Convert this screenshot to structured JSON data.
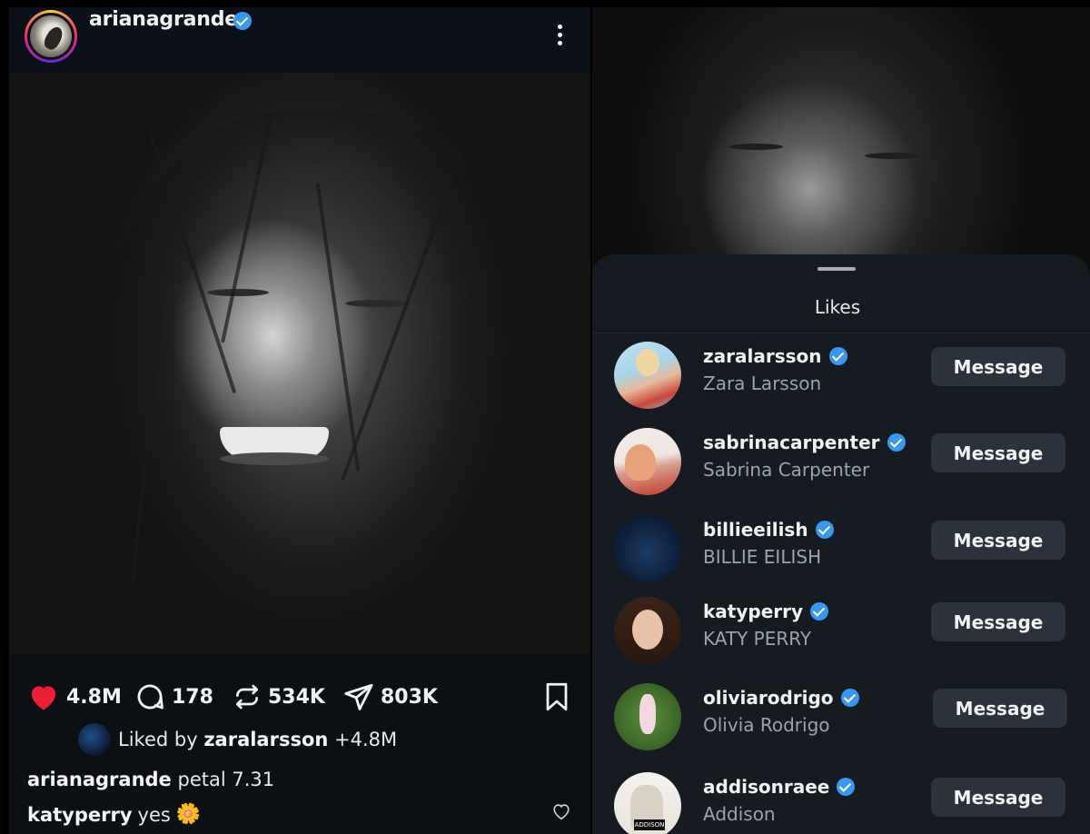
{
  "post": {
    "username": "arianagrande",
    "stats": {
      "likes": "4.8M",
      "comments": "178",
      "reposts": "534K",
      "shares": "803K"
    },
    "liked_by": {
      "prefix": "Liked by ",
      "user": "zaralarsson",
      "suffix": " +4.8M"
    },
    "caption": {
      "user": "arianagrande",
      "text": " petal 7.31"
    },
    "comment": {
      "user": "katyperry",
      "text": "yes",
      "emoji": "🌼"
    },
    "colors": {
      "like_red": "#ee1d36",
      "verified_blue": "#3897f0"
    }
  },
  "likes_sheet": {
    "title": "Likes",
    "button_label": "Message",
    "users": [
      {
        "username": "zaralarsson",
        "name": "Zara Larsson"
      },
      {
        "username": "sabrinacarpenter",
        "name": "Sabrina Carpenter"
      },
      {
        "username": "billieeilish",
        "name": "BILLIE EILISH"
      },
      {
        "username": "katyperry",
        "name": "KATY PERRY"
      },
      {
        "username": "oliviarodrigo",
        "name": "Olivia Rodrigo"
      },
      {
        "username": "addisonraee",
        "name": "Addison",
        "avatar_text": "ADDISON"
      }
    ]
  }
}
